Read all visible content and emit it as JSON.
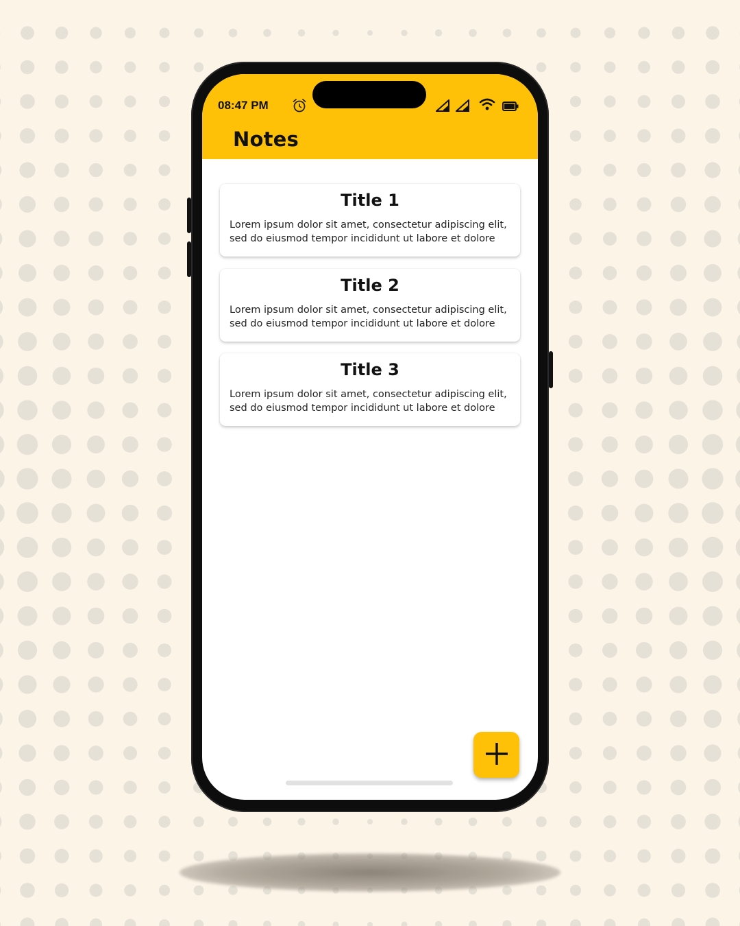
{
  "status_bar": {
    "time": "08:47 PM",
    "icons": [
      "alarm-icon",
      "signal-icon",
      "signal-icon",
      "wifi-icon",
      "battery-icon"
    ]
  },
  "app_bar": {
    "title": "Notes",
    "color": "#ffc107"
  },
  "notes": [
    {
      "title": "Title 1",
      "body": "Lorem ipsum dolor sit amet, consectetur adipiscing elit, sed do eiusmod tempor incididunt ut labore et dolore"
    },
    {
      "title": "Title 2",
      "body": "Lorem ipsum dolor sit amet, consectetur adipiscing elit, sed do eiusmod tempor incididunt ut labore et dolore"
    },
    {
      "title": "Title 3",
      "body": "Lorem ipsum dolor sit amet, consectetur adipiscing elit, sed do eiusmod tempor incididunt ut labore et dolore"
    }
  ],
  "fab": {
    "icon": "plus-icon",
    "color": "#ffc107"
  },
  "colors": {
    "background": "#fdf4e8",
    "dots": "#e6e1d6"
  }
}
